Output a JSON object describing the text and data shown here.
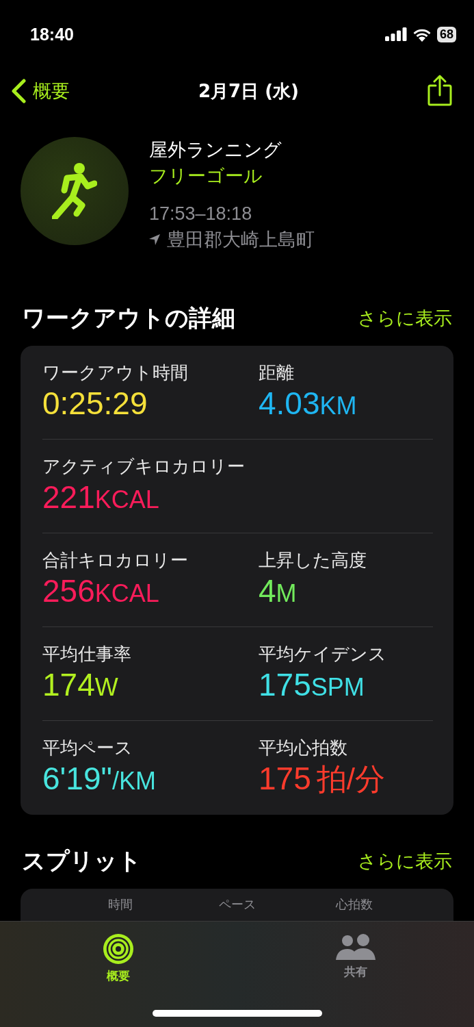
{
  "status_bar": {
    "time": "18:40",
    "battery": "68"
  },
  "nav": {
    "back": "概要",
    "title": "2月7日 (水)"
  },
  "workout": {
    "type": "屋外ランニング",
    "goal": "フリーゴール",
    "time_range": "17:53–18:18",
    "location": "豊田郡大崎上島町"
  },
  "details": {
    "title": "ワークアウトの詳細",
    "more": "さらに表示",
    "rows": [
      [
        {
          "label": "ワークアウト時間",
          "value": "0:25:29",
          "color": "#f5e03a"
        },
        {
          "label": "距離",
          "value": "4.03",
          "unit": "KM",
          "kind": "small",
          "color": "#1fb6f2"
        }
      ],
      [
        {
          "label": "アクティブキロカロリー",
          "value": "221",
          "unit": "KCAL",
          "kind": "small",
          "color": "#fa1c5a"
        }
      ],
      [
        {
          "label": "合計キロカロリー",
          "value": "256",
          "unit": "KCAL",
          "kind": "small",
          "color": "#fa1c5a"
        },
        {
          "label": "上昇した高度",
          "value": "4",
          "unit": "M",
          "kind": "small",
          "color": "#72ea5c"
        }
      ],
      [
        {
          "label": "平均仕事率",
          "value": "174",
          "unit": "W",
          "kind": "small",
          "color": "#b2f020"
        },
        {
          "label": "平均ケイデンス",
          "value": "175",
          "unit": "SPM",
          "kind": "small",
          "color": "#40e0e6"
        }
      ],
      [
        {
          "label": "平均ペース",
          "value": "6'19\"",
          "unit": "/KM",
          "kind": "small",
          "color": "#48e4de"
        },
        {
          "label": "平均心拍数",
          "value": "175",
          "unit": "拍/分",
          "kind": "full",
          "color": "#ff3b2c"
        }
      ]
    ]
  },
  "splits": {
    "title": "スプリット",
    "more": "さらに表示",
    "columns": [
      "時間",
      "ペース",
      "心拍数"
    ]
  },
  "tabs": [
    {
      "label": "概要",
      "selected": true,
      "kind": "rings"
    },
    {
      "label": "共有",
      "selected": false,
      "kind": "people"
    }
  ]
}
